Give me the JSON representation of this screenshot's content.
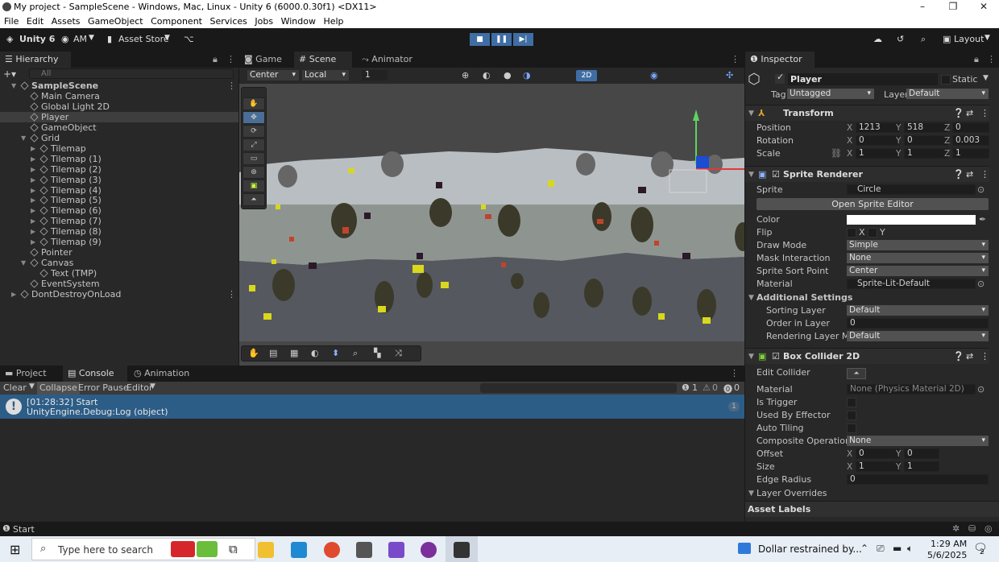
{
  "window": {
    "title": "My project - SampleScene - Windows, Mac, Linux - Unity 6 (6000.0.30f1) <DX11>",
    "min": "–",
    "max": "❐",
    "close": "✕"
  },
  "menu": [
    "File",
    "Edit",
    "Assets",
    "GameObject",
    "Component",
    "Services",
    "Jobs",
    "Window",
    "Help"
  ],
  "toolbar": {
    "unity": "Unity 6",
    "account": "AM",
    "store": "Asset Store",
    "layout": "Layout"
  },
  "hierarchy": {
    "tab": "Hierarchy",
    "search_placeholder": "All",
    "items": [
      {
        "label": "SampleScene",
        "depth": 0,
        "bold": true,
        "arrow": "▼"
      },
      {
        "label": "Main Camera",
        "depth": 1
      },
      {
        "label": "Global Light 2D",
        "depth": 1
      },
      {
        "label": "Player",
        "depth": 1,
        "selected": true
      },
      {
        "label": "GameObject",
        "depth": 1
      },
      {
        "label": "Grid",
        "depth": 1,
        "arrow": "▼"
      },
      {
        "label": "Tilemap",
        "depth": 2,
        "arrow": "▶"
      },
      {
        "label": "Tilemap (1)",
        "depth": 2,
        "arrow": "▶"
      },
      {
        "label": "Tilemap (2)",
        "depth": 2,
        "arrow": "▶"
      },
      {
        "label": "Tilemap (3)",
        "depth": 2,
        "arrow": "▶"
      },
      {
        "label": "Tilemap (4)",
        "depth": 2,
        "arrow": "▶"
      },
      {
        "label": "Tilemap (5)",
        "depth": 2,
        "arrow": "▶"
      },
      {
        "label": "Tilemap (6)",
        "depth": 2,
        "arrow": "▶"
      },
      {
        "label": "Tilemap (7)",
        "depth": 2,
        "arrow": "▶"
      },
      {
        "label": "Tilemap (8)",
        "depth": 2,
        "arrow": "▶"
      },
      {
        "label": "Tilemap (9)",
        "depth": 2,
        "arrow": "▶"
      },
      {
        "label": "Pointer",
        "depth": 1
      },
      {
        "label": "Canvas",
        "depth": 1,
        "arrow": "▼"
      },
      {
        "label": "Text (TMP)",
        "depth": 2
      },
      {
        "label": "EventSystem",
        "depth": 1
      },
      {
        "label": "DontDestroyOnLoad",
        "depth": 0,
        "arrow": "▶"
      }
    ]
  },
  "scene_tabs": {
    "game": "Game",
    "scene": "Scene",
    "animator": "Animator"
  },
  "scene_toolbar": {
    "pivot": "Center",
    "space": "Local",
    "grid": "1",
    "mode2d": "2D"
  },
  "bottom": {
    "tabs": {
      "project": "Project",
      "console": "Console",
      "animation": "Animation"
    },
    "clear": "Clear",
    "collapse": "Collapse",
    "error_pause": "Error Pause",
    "editor": "Editor",
    "counts": {
      "info": "1",
      "warn": "0",
      "error": "0"
    },
    "log": {
      "line1": "[01:28:32] Start",
      "line2": "UnityEngine.Debug:Log (object)",
      "count": "1"
    }
  },
  "status": "Start",
  "inspector": {
    "tab": "Inspector",
    "object": "Player",
    "static": "Static",
    "tag_label": "Tag",
    "tag": "Untagged",
    "layer_label": "Layer",
    "layer": "Default",
    "transform": {
      "title": "Transform",
      "position": {
        "label": "Position",
        "x": "1213",
        "y": "518",
        "z": "0"
      },
      "rotation": {
        "label": "Rotation",
        "x": "0",
        "y": "0",
        "z": "0.003"
      },
      "scale": {
        "label": "Scale",
        "x": "1",
        "y": "1",
        "z": "1"
      }
    },
    "sprite_renderer": {
      "title": "Sprite Renderer",
      "sprite_label": "Sprite",
      "sprite": "Circle",
      "open_editor": "Open Sprite Editor",
      "color_label": "Color",
      "flip_label": "Flip",
      "draw_mode_label": "Draw Mode",
      "draw_mode": "Simple",
      "mask_label": "Mask Interaction",
      "mask": "None",
      "sort_point_label": "Sprite Sort Point",
      "sort_point": "Center",
      "material_label": "Material",
      "material": "Sprite-Lit-Default",
      "additional": "Additional Settings",
      "sorting_layer_label": "Sorting Layer",
      "sorting_layer": "Default",
      "order_label": "Order in Layer",
      "order": "0",
      "rendering_layer_label": "Rendering Layer Mas",
      "rendering_layer": "Default"
    },
    "box_collider": {
      "title": "Box Collider 2D",
      "edit_label": "Edit Collider",
      "material_label": "Material",
      "material": "None (Physics Material 2D)",
      "trigger_label": "Is Trigger",
      "effector_label": "Used By Effector",
      "tiling_label": "Auto Tiling",
      "composite_label": "Composite Operation",
      "composite": "None",
      "offset_label": "Offset",
      "offset_x": "0",
      "offset_y": "0",
      "size_label": "Size",
      "size_x": "1",
      "size_y": "1",
      "radius_label": "Edge Radius",
      "radius": "0",
      "overrides": "Layer Overrides"
    },
    "asset_labels": "Asset Labels"
  },
  "taskbar": {
    "search": "Type here to search",
    "news": "Dollar restrained by...",
    "time": "1:29 AM",
    "date": "5/6/2025",
    "notif": "2"
  }
}
